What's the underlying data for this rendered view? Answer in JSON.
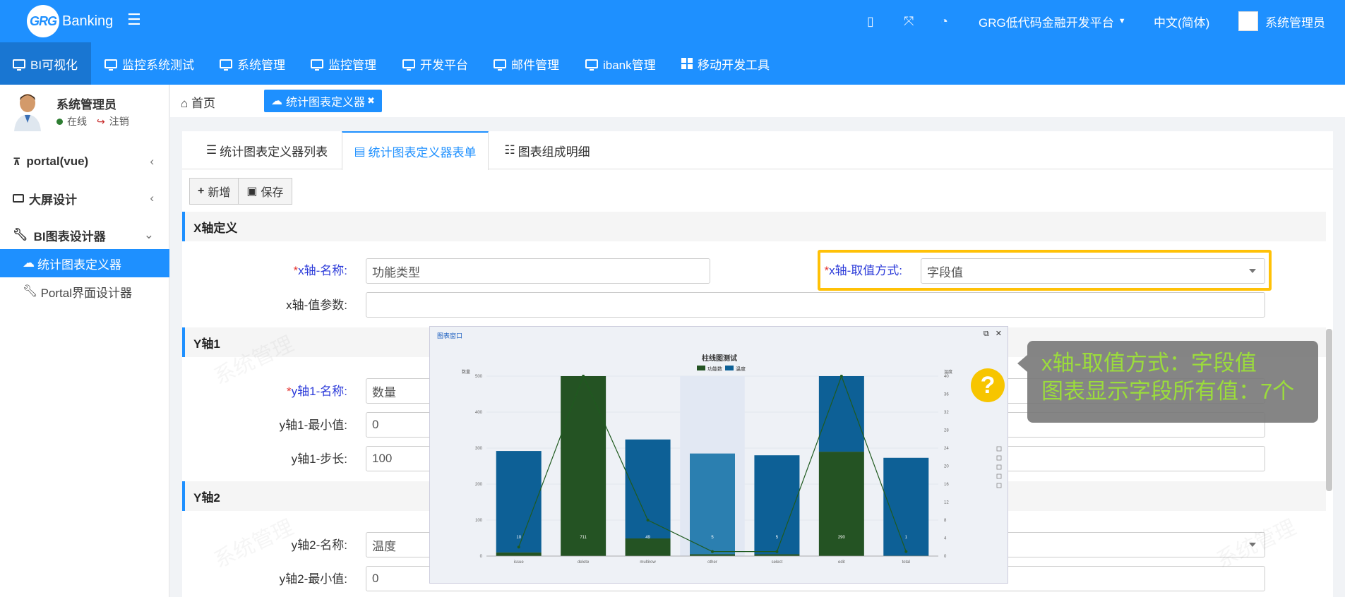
{
  "brand": {
    "logo_mark": "GRG",
    "logo_text": "Banking"
  },
  "topbar": {
    "icons": [
      "document-icon",
      "fullscreen-icon",
      "dashboard-icon"
    ],
    "platform": "GRG低代码金融开发平台",
    "language": "中文(简体)",
    "user": "系统管理员"
  },
  "menu": [
    {
      "label": "BI可视化",
      "active": true
    },
    {
      "label": "监控系统测试"
    },
    {
      "label": "系统管理"
    },
    {
      "label": "监控管理"
    },
    {
      "label": "开发平台"
    },
    {
      "label": "邮件管理"
    },
    {
      "label": "ibank管理"
    },
    {
      "label": "移动开发工具"
    }
  ],
  "sidebar": {
    "user_name": "系统管理员",
    "status_online": "在线",
    "logout": "注销",
    "items": [
      {
        "label": "portal(vue)",
        "chev": "‹"
      },
      {
        "label": "大屏设计",
        "chev": "‹"
      },
      {
        "label": "BI图表设计器",
        "chev": "⌄"
      }
    ],
    "sub_items": [
      {
        "label": "统计图表定义器",
        "active": true
      },
      {
        "label": "Portal界面设计器"
      }
    ]
  },
  "tabbar": {
    "home": "首页",
    "open_tab": "统计图表定义器"
  },
  "subtabs": [
    "统计图表定义器列表",
    "统计图表定义器表单",
    "图表组成明细"
  ],
  "toolbar": {
    "add": "新增",
    "save": "保存"
  },
  "sections": {
    "x": "X轴定义",
    "y1": "Y轴1",
    "y2": "Y轴2"
  },
  "form": {
    "x_name_label": "x轴-名称:",
    "x_name_value": "功能类型",
    "x_mode_label": "x轴-取值方式:",
    "x_mode_value": "字段值",
    "x_param_label": "x轴-值参数:",
    "x_param_value": "",
    "y1_name_label": "y轴1-名称:",
    "y1_name_value": "数量",
    "y1_min_label": "y轴1-最小值:",
    "y1_min_value": "0",
    "y1_step_label": "y轴1-步长:",
    "y1_step_value": "100",
    "y2_name_label": "y轴2-名称:",
    "y2_name_value": "温度",
    "y2_min_label": "y轴2-最小值:",
    "y2_min_value": "0"
  },
  "popup": {
    "title": "图表窗口"
  },
  "tooltip": {
    "line1": "x轴-取值方式：字段值",
    "line2": "图表显示字段所有值：7个"
  },
  "watermark": "系统管理",
  "chart_data": {
    "type": "bar",
    "title": "柱线图测试",
    "legend": [
      "功能数",
      "温度"
    ],
    "ylabel": "数量",
    "y2label": "温度",
    "ylim": [
      0,
      500
    ],
    "y2lim": [
      0,
      40
    ],
    "categories": [
      "issue",
      "delete",
      "multirow",
      "other",
      "select",
      "edit",
      "total"
    ],
    "series": [
      {
        "name": "功能数",
        "type": "bar",
        "values": [
          10,
          711,
          49,
          5,
          5,
          290,
          1
        ]
      },
      {
        "name": "温度",
        "type": "bar",
        "values": [
          282,
          0,
          275,
          280,
          275,
          212,
          272
        ]
      }
    ],
    "line": {
      "name": "温度",
      "values": [
        2,
        45,
        8,
        1,
        1,
        45,
        1
      ]
    },
    "colors": {
      "green": "#245323",
      "blue": "#0d6096",
      "highlight": "#2b7fb0"
    }
  }
}
